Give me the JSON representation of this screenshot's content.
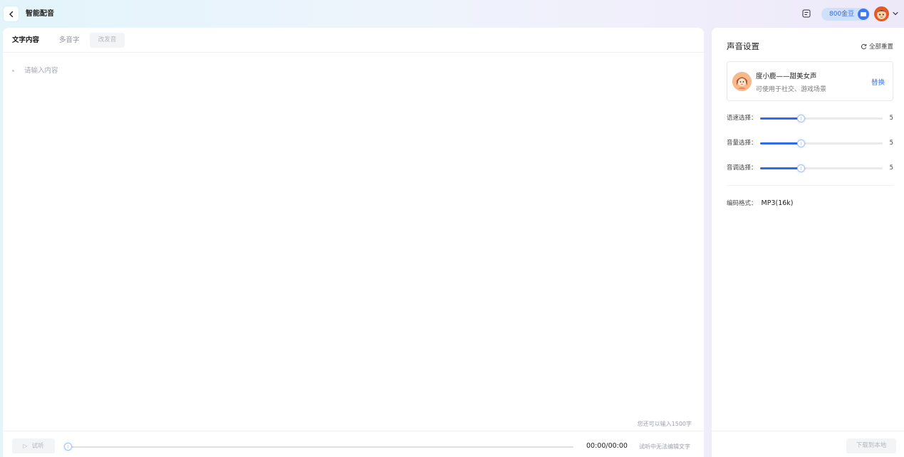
{
  "header": {
    "title": "智能配音",
    "beans_text": "800金豆",
    "back_icon": "chevron-left-icon",
    "doc_icon": "document-icon",
    "coin_icon": "coin-icon",
    "avatar_icon": "user-avatar-icon"
  },
  "editor": {
    "tabs": [
      {
        "label": "文字内容",
        "active": true
      },
      {
        "label": "多音字",
        "active": false
      },
      {
        "label": "改发音",
        "active": false,
        "disabled": true
      }
    ],
    "placeholder": "请输入内容",
    "remaining_text": "您还可以输入1500字"
  },
  "playbar": {
    "play_label": "试听",
    "progress": 0,
    "time": "00:00/00:00",
    "hint": "试听中无法编辑文字"
  },
  "settings": {
    "title": "声音设置",
    "reset_label": "全部重置",
    "voice": {
      "name": "度小鹿——甜美女声",
      "description": "可使用于社交、游戏场景",
      "replace_label": "替换"
    },
    "sliders": [
      {
        "label": "语速选择：",
        "value": "5",
        "fraction": 0.33
      },
      {
        "label": "音量选择：",
        "value": "5",
        "fraction": 0.33
      },
      {
        "label": "音调选择：",
        "value": "5",
        "fraction": 0.33
      }
    ],
    "format_label": "编码格式：",
    "format_value": "MP3(16k)",
    "download_label": "下载到本地"
  },
  "colors": {
    "accent": "#2f6bea",
    "link": "#3f78f0"
  }
}
